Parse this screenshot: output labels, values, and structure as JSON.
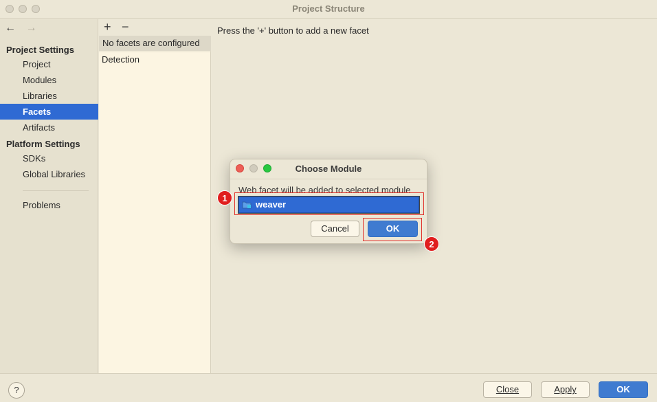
{
  "window": {
    "title": "Project Structure"
  },
  "nav": {
    "back": "←",
    "forward": "→"
  },
  "sidebar": {
    "project_settings_header": "Project Settings",
    "project_items": [
      "Project",
      "Modules",
      "Libraries",
      "Facets",
      "Artifacts"
    ],
    "platform_settings_header": "Platform Settings",
    "platform_items": [
      "SDKs",
      "Global Libraries"
    ],
    "problems": "Problems",
    "selected": "Facets"
  },
  "facets": {
    "add_label": "+",
    "remove_label": "−",
    "empty_message": "No facets are configured",
    "detection": "Detection"
  },
  "main": {
    "hint": "Press the '+' button to add a new facet"
  },
  "dialog": {
    "title": "Choose Module",
    "message": "Web facet will be added to selected module",
    "modules": [
      "weaver"
    ],
    "selected_module": "weaver",
    "cancel_label": "Cancel",
    "ok_label": "OK"
  },
  "callouts": {
    "one": "1",
    "two": "2"
  },
  "bottom": {
    "help_label": "?",
    "close_label": "Close",
    "apply_label": "Apply",
    "ok_label": "OK"
  },
  "colors": {
    "selection": "#2f6ad3",
    "primary_button": "#3f7bd0",
    "callout_red": "#e01e1e",
    "traffic_close": "#ed5f57",
    "traffic_min": "#d1ccbd",
    "traffic_zoom": "#27c840"
  }
}
